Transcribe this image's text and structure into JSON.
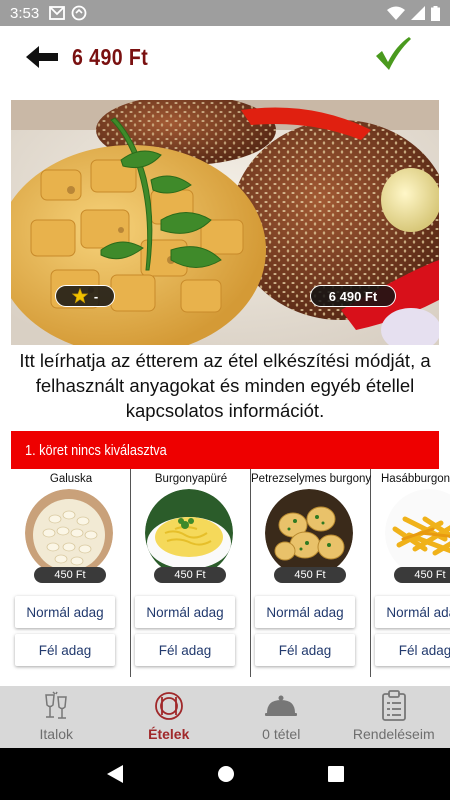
{
  "status_bar": {
    "time": "3:53"
  },
  "header": {
    "price_title": "6 490 Ft"
  },
  "hero": {
    "rating": "-",
    "price": "6 490 Ft"
  },
  "description": "Itt leírhatja az étterem az étel elkészítési módját, a felhasznált anyagokat és minden egyéb étellel kapcsolatos információt.",
  "side_section": {
    "title": "1. köret nincs kiválasztva",
    "items": [
      {
        "name": "Galuska",
        "price": "450 Ft",
        "full_label": "Normál adag",
        "half_label": "Fél adag"
      },
      {
        "name": "Burgonyapüré",
        "price": "450 Ft",
        "full_label": "Normál adag",
        "half_label": "Fél adag"
      },
      {
        "name": "Petrezselymes burgonya",
        "price": "450 Ft",
        "full_label": "Normál adag",
        "half_label": "Fél adag"
      },
      {
        "name": "Hasábburgonya",
        "price": "450 Ft",
        "full_label": "Normál adag",
        "half_label": "Fél adag"
      }
    ]
  },
  "tabs": [
    {
      "label": "Italok",
      "icon": "drinks-icon",
      "active": false
    },
    {
      "label": "Ételek",
      "icon": "food-icon",
      "active": true
    },
    {
      "label": "0 tétel",
      "icon": "cloche-icon",
      "active": false
    },
    {
      "label": "Rendeléseim",
      "icon": "clipboard-icon",
      "active": false
    }
  ],
  "colors": {
    "accent_red": "#ee0000",
    "title_dark_red": "#7a1010",
    "active_tab": "#a0282a",
    "check_green": "#4a9a1e"
  }
}
